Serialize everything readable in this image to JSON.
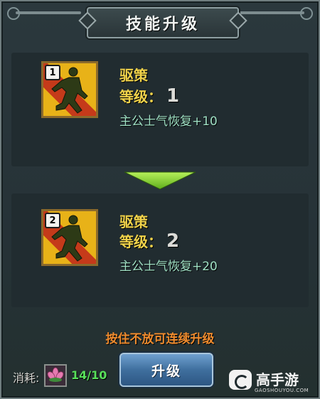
{
  "dialog": {
    "title": "技能升级"
  },
  "current_skill": {
    "icon": "running-warrior-icon",
    "badge": "1",
    "name": "驱策",
    "level_label": "等级：",
    "level_value": "1",
    "effect": "主公士气恢复+10"
  },
  "next_skill": {
    "icon": "running-warrior-icon",
    "badge": "2",
    "name": "驱策",
    "level_label": "等级：",
    "level_value": "2",
    "effect": "主公士气恢复+20"
  },
  "hint": "按住不放可连续升级",
  "cost": {
    "label": "消耗:",
    "item_icon": "lotus-flower-icon",
    "count": "14/10"
  },
  "upgrade_button": "升级",
  "watermark": {
    "brand": "高手游",
    "site": "GAOSHOUYOU.COM"
  },
  "colors": {
    "accent_gold": "#f0d24a",
    "effect_teal": "#9fe0c4",
    "hint_orange": "#ee8b2e",
    "count_green": "#58e05a",
    "button_blue": "#3f6f9e"
  }
}
